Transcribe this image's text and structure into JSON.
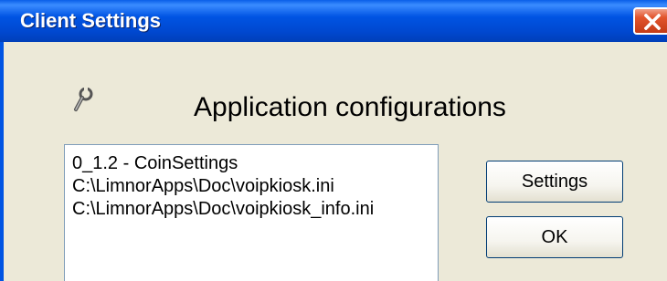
{
  "window": {
    "title": "Client Settings",
    "close_icon": "close-icon"
  },
  "header": {
    "icon": "wrench-icon",
    "heading": "Application configurations"
  },
  "list": {
    "items": [
      "0_1.2 - CoinSettings",
      "C:\\LimnorApps\\Doc\\voipkiosk.ini",
      "C:\\LimnorApps\\Doc\\voipkiosk_info.ini"
    ]
  },
  "buttons": {
    "settings_label": "Settings",
    "ok_label": "OK"
  },
  "colors": {
    "titlebar": "#0054e3",
    "close_button": "#e2552d",
    "window_face": "#ece9d8"
  }
}
